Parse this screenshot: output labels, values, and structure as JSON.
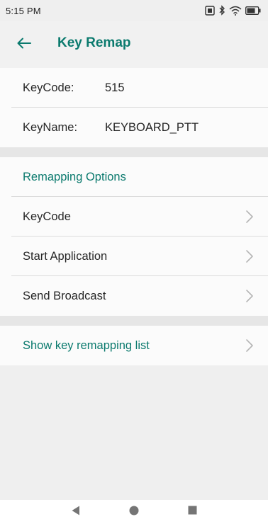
{
  "status_bar": {
    "time": "5:15 PM",
    "icons": [
      "screenshot-icon",
      "bluetooth-icon",
      "wifi-icon",
      "battery-icon"
    ]
  },
  "app_bar": {
    "title": "Key Remap",
    "back_icon": "arrow-left-icon"
  },
  "key_info": {
    "keycode_label": "KeyCode:",
    "keycode_value": "515",
    "keyname_label": "KeyName:",
    "keyname_value": "KEYBOARD_PTT"
  },
  "remapping_options": {
    "header": "Remapping Options",
    "items": [
      {
        "label": "KeyCode"
      },
      {
        "label": "Start Application"
      },
      {
        "label": "Send Broadcast"
      }
    ]
  },
  "footer_link": {
    "label": "Show key remapping list"
  },
  "nav_bar": {
    "buttons": [
      "back-triangle-icon",
      "home-circle-icon",
      "recents-square-icon"
    ]
  },
  "colors": {
    "accent": "#0b7a6e",
    "background": "#efefef",
    "row_background": "#fbfbfb",
    "text": "#262626",
    "chevron": "#b5b5b5"
  }
}
